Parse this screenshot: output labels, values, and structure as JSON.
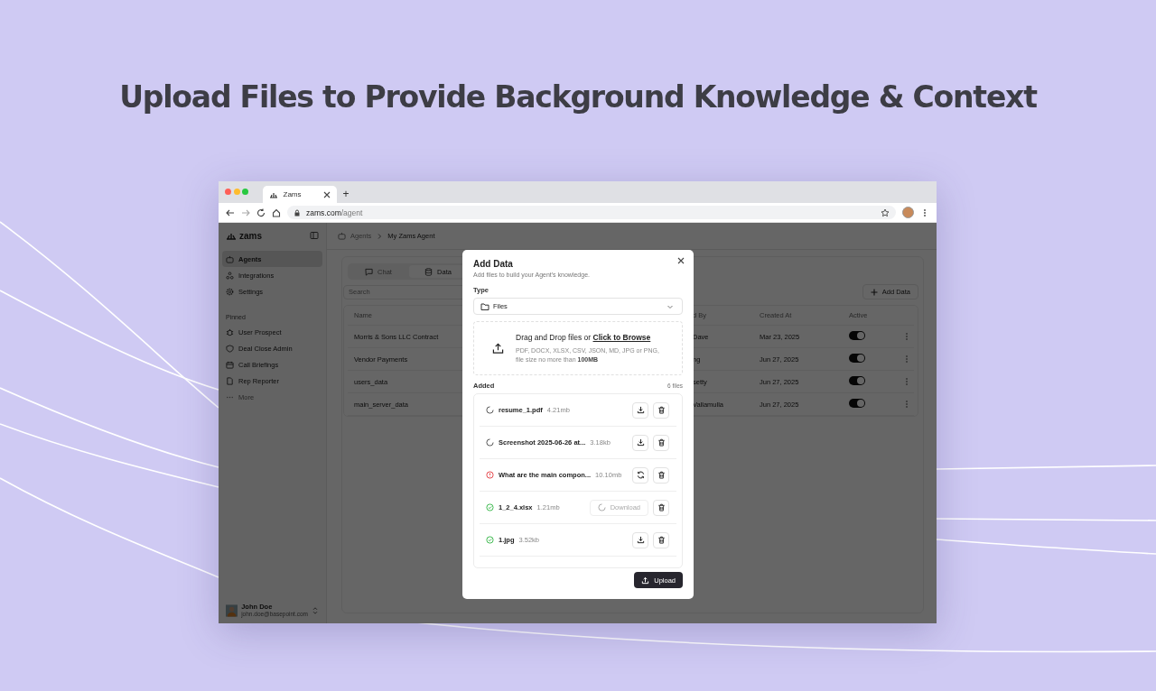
{
  "headline": "Upload Files to Provide Background Knowledge & Context",
  "browser": {
    "tab_title": "Zams",
    "new_tab": "+",
    "url_host": "zams.com",
    "url_path": "/agent"
  },
  "sidebar": {
    "logo": "zams",
    "items": [
      {
        "label": "Agents",
        "selected": true
      },
      {
        "label": "Integrations",
        "selected": false
      },
      {
        "label": "Settings",
        "selected": false
      }
    ],
    "pinned_heading": "Pinned",
    "pinned": [
      {
        "label": "User Prospect",
        "kind": "item"
      },
      {
        "label": "Deal Close Admin",
        "kind": "item"
      },
      {
        "label": "Call Briefings",
        "kind": "item"
      },
      {
        "label": "Rep Reporter",
        "kind": "item"
      },
      {
        "label": "More",
        "kind": "more"
      }
    ],
    "user": {
      "name": "John Doe",
      "email": "john.doe@basepoint.com"
    }
  },
  "breadcrumb": [
    "Agents",
    "My Zams Agent"
  ],
  "tabs": [
    {
      "label": "Chat",
      "selected": false
    },
    {
      "label": "Data",
      "selected": true
    }
  ],
  "search": {
    "placeholder": "Search"
  },
  "add_button": "Add Data",
  "table": {
    "columns": [
      "Name",
      "d By",
      "Created At",
      "Active"
    ],
    "rows": [
      {
        "name": "Morris & Sons LLC Contract",
        "by": "Dave",
        "created": "Mar 23, 2025",
        "active": true
      },
      {
        "name": "Vendor Payments",
        "by": "ng",
        "created": "Jun 27, 2025",
        "active": true
      },
      {
        "name": "users_data",
        "by": "setty",
        "created": "Jun 27, 2025",
        "active": true
      },
      {
        "name": "main_server_data",
        "by": "Vallamulla",
        "created": "Jun 27, 2025",
        "active": true
      }
    ]
  },
  "modal": {
    "title": "Add Data",
    "subtitle": "Add files to build your Agent's knowledge.",
    "type_label": "Type",
    "type_value": "Files",
    "drop_text": "Drag and Drop files or",
    "drop_link": "Click to Browse",
    "drop_hint": "PDF, DOCX, XLSX, CSV, JSON, MD, JPG or PNG, file size no more than **100MB**",
    "added_label": "Added",
    "count": "6 files",
    "files": [
      {
        "name": "resume_1.pdf",
        "size": "4.21mb",
        "kind": "pending",
        "downloading": false
      },
      {
        "name": "Screenshot 2025-06-26 at...",
        "size": "3.18kb",
        "kind": "pending",
        "downloading": false
      },
      {
        "name": "What are the main compon...",
        "size": "10.10mb",
        "kind": "failed",
        "downloading": false
      },
      {
        "name": "1_2_4.xlsx",
        "size": "1.21mb",
        "kind": "done",
        "downloading": true,
        "download_label": "Download"
      },
      {
        "name": "1.jpg",
        "size": "3.52kb",
        "kind": "done",
        "downloading": false
      }
    ],
    "upload_button": "Upload"
  }
}
